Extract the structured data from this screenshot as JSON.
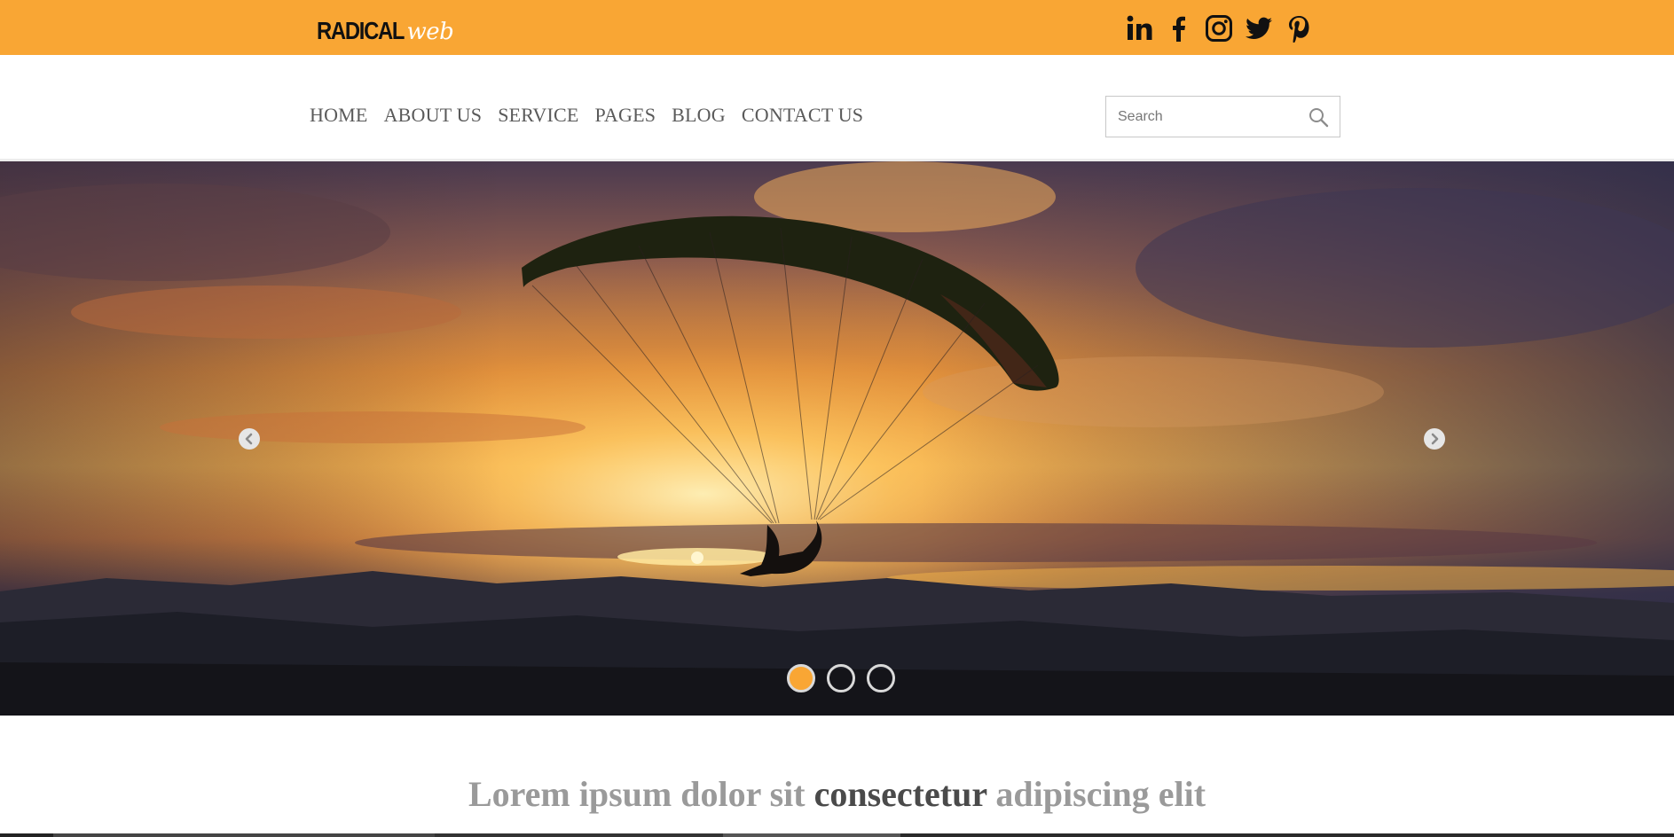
{
  "brand": {
    "logo_main": "RADICAL",
    "logo_sub": "web",
    "accent_color": "#f9a634"
  },
  "social": [
    {
      "name": "linkedin-icon"
    },
    {
      "name": "facebook-icon"
    },
    {
      "name": "instagram-icon"
    },
    {
      "name": "twitter-icon"
    },
    {
      "name": "pinterest-icon"
    }
  ],
  "nav": {
    "items": [
      "HOME",
      "ABOUT US",
      "SERVICE",
      "PAGES",
      "BLOG",
      "CONTACT US"
    ]
  },
  "search": {
    "placeholder": "Search",
    "icon": "search-icon"
  },
  "hero": {
    "prev_icon": "chevron-left-icon",
    "next_icon": "chevron-right-icon",
    "slide_count": 3,
    "active_slide": 1
  },
  "headline": {
    "part1": "Lorem ipsum dolor sit",
    "part2": "consectetur",
    "part3": "adipiscing elit"
  }
}
